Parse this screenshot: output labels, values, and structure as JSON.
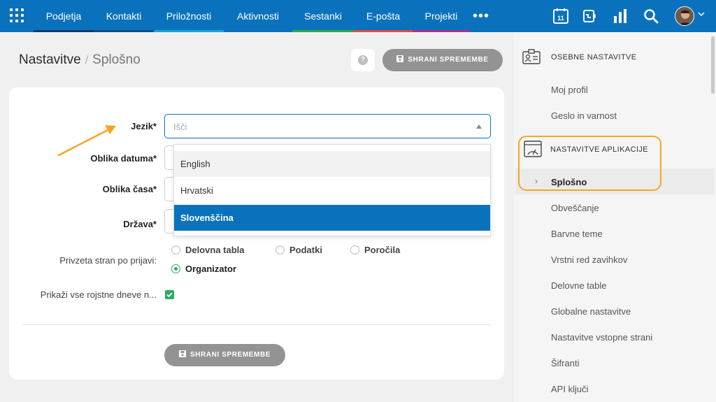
{
  "topnav": {
    "items": [
      {
        "label": "Podjetja",
        "bar_color": "#0a3a6a"
      },
      {
        "label": "Kontakti",
        "bar_color": "#0d4d85"
      },
      {
        "label": "Priložnosti",
        "bar_color": "#1fa3d6"
      },
      {
        "label": "Aktivnosti",
        "bar_color": "#0a72bc"
      },
      {
        "label": "Sestanki",
        "bar_color": "#2ca84a"
      },
      {
        "label": "E-pošta",
        "bar_color": "#e34b3d"
      },
      {
        "label": "Projekti",
        "bar_color": "#b02d8e"
      }
    ],
    "more": "•••",
    "calendar_day": "11",
    "icons": [
      "grid-icon",
      "calendar-icon",
      "phone-icon",
      "chart-icon",
      "search-icon"
    ]
  },
  "header": {
    "breadcrumb_main": "Nastavitve",
    "breadcrumb_sep": "/",
    "breadcrumb_sub": "Splošno",
    "help": "?",
    "save_label": "SHRANI SPREMEMBE"
  },
  "form": {
    "language_label": "Jezik*",
    "language_value": "Išči",
    "date_format_label": "Oblika datuma*",
    "time_format_label": "Oblika časa*",
    "country_label": "Država*",
    "landing_label": "Privzeta stran po prijavi:",
    "birthdays_label": "Prikaži vse rojstne dneve n...",
    "landing_options": [
      {
        "label": "Delovna tabla",
        "selected": false
      },
      {
        "label": "Podatki",
        "selected": false
      },
      {
        "label": "Poročila",
        "selected": false
      },
      {
        "label": "Organizator",
        "selected": true
      }
    ],
    "birthdays_checked": true,
    "save_label": "SHRANI SPREMEMBE"
  },
  "dropdown": {
    "options": [
      "English",
      "Hrvatski",
      "Slovenščina"
    ],
    "selected": "Slovenščina",
    "hovered": "English"
  },
  "sidebar": {
    "personal_heading": "OSEBNE NASTAVITVE",
    "personal_items": [
      "Moj profil",
      "Geslo in varnost"
    ],
    "app_heading": "NASTAVITVE APLIKACIJE",
    "active_item": "Splošno",
    "app_items": [
      "Obveščanje",
      "Barvne teme",
      "Vrstni red zavihkov",
      "Delovne table",
      "Globalne nastavitve",
      "Nastavitve vstopne strani",
      "Šifranti",
      "API ključi"
    ]
  },
  "colors": {
    "brand": "#0a72bc",
    "accent": "#27ae60",
    "annotation": "#f5a623"
  }
}
